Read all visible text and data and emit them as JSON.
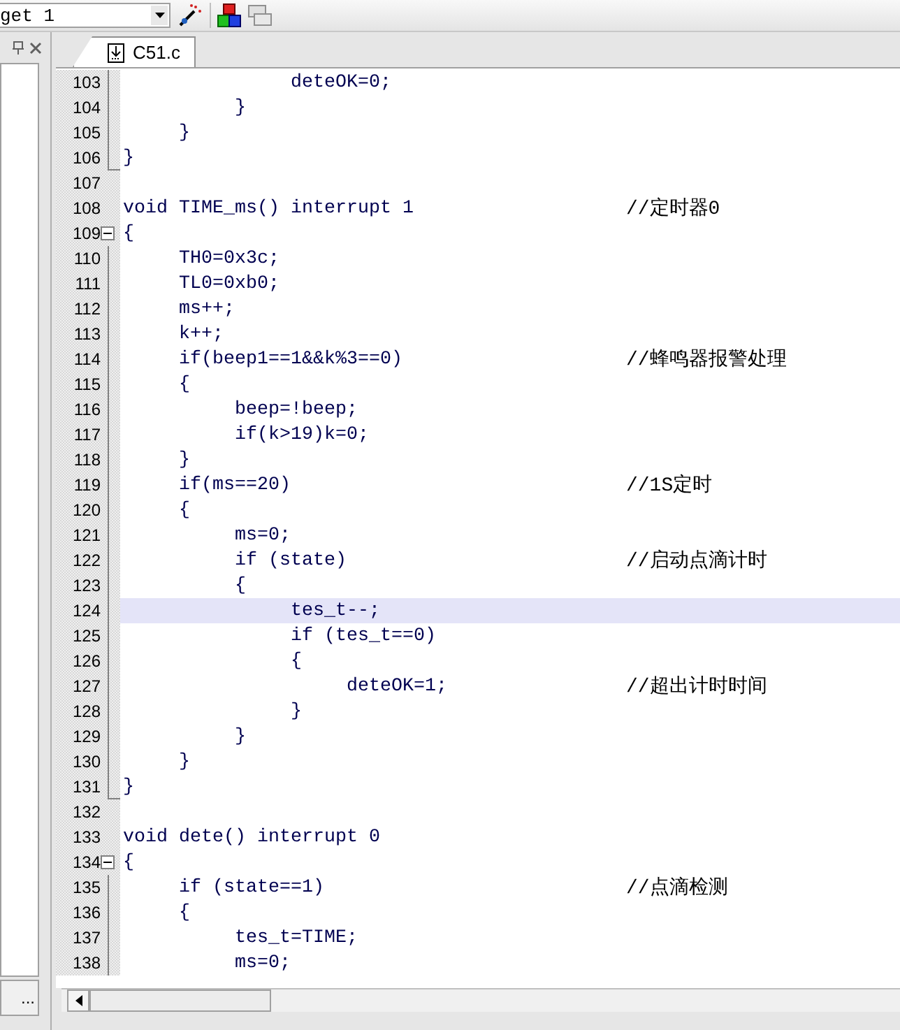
{
  "toolbar": {
    "target": "get 1"
  },
  "left_panel": {
    "tab_label": "..."
  },
  "editor": {
    "tab": {
      "label": "C51.c",
      "selected": true
    },
    "lines": [
      {
        "number": "103",
        "code": "               deteOK=0;",
        "kind": "fold-body",
        "current": false
      },
      {
        "number": "104",
        "code": "          }",
        "kind": "fold-body",
        "current": false
      },
      {
        "number": "105",
        "code": "     }",
        "kind": "fold-body",
        "current": false
      },
      {
        "number": "106",
        "code": "}",
        "kind": "fold-end",
        "current": false
      },
      {
        "number": "107",
        "kind": "plain",
        "current": false
      },
      {
        "number": "108",
        "code": "void TIME_ms() interrupt 1",
        "comment": "//定时器0",
        "kind": "plain",
        "current": false
      },
      {
        "number": "109",
        "code": "{",
        "kind": "fold-start",
        "current": false
      },
      {
        "number": "110",
        "code": "     TH0=0x3c;",
        "kind": "fold-body",
        "current": false
      },
      {
        "number": "111",
        "code": "     TL0=0xb0;",
        "kind": "fold-body",
        "current": false
      },
      {
        "number": "112",
        "code": "     ms++;",
        "kind": "fold-body",
        "current": false
      },
      {
        "number": "113",
        "code": "     k++;",
        "kind": "fold-body",
        "current": false
      },
      {
        "number": "114",
        "code": "     if(beep1==1&&k%3==0)",
        "comment": "//蜂鸣器报警处理",
        "kind": "fold-body",
        "current": false
      },
      {
        "number": "115",
        "code": "     {",
        "kind": "fold-body",
        "current": false
      },
      {
        "number": "116",
        "code": "          beep=!beep;",
        "kind": "fold-body",
        "current": false
      },
      {
        "number": "117",
        "code": "          if(k>19)k=0;",
        "kind": "fold-body",
        "current": false
      },
      {
        "number": "118",
        "code": "     }",
        "kind": "fold-body",
        "current": false
      },
      {
        "number": "119",
        "code": "     if(ms==20)",
        "comment": "//1S定时",
        "kind": "fold-body",
        "current": false
      },
      {
        "number": "120",
        "code": "     {",
        "kind": "fold-body",
        "current": false
      },
      {
        "number": "121",
        "code": "          ms=0;",
        "kind": "fold-body",
        "current": false
      },
      {
        "number": "122",
        "code": "          if (state)",
        "comment": "//启动点滴计时",
        "kind": "fold-body",
        "current": false
      },
      {
        "number": "123",
        "code": "          {",
        "kind": "fold-body",
        "current": false
      },
      {
        "number": "124",
        "code": "               tes_t--;",
        "kind": "fold-body",
        "current": true
      },
      {
        "number": "125",
        "code": "               if (tes_t==0)",
        "kind": "fold-body",
        "current": false
      },
      {
        "number": "126",
        "code": "               {",
        "kind": "fold-body",
        "current": false
      },
      {
        "number": "127",
        "code": "                    deteOK=1;",
        "comment": "//超出计时时间",
        "kind": "fold-body",
        "current": false
      },
      {
        "number": "128",
        "code": "               }",
        "kind": "fold-body",
        "current": false
      },
      {
        "number": "129",
        "code": "          }",
        "kind": "fold-body",
        "current": false
      },
      {
        "number": "130",
        "code": "     }",
        "kind": "fold-body",
        "current": false
      },
      {
        "number": "131",
        "code": "}",
        "kind": "fold-end",
        "current": false
      },
      {
        "number": "132",
        "kind": "plain",
        "current": false
      },
      {
        "number": "133",
        "code": "void dete() interrupt 0",
        "kind": "plain",
        "current": false
      },
      {
        "number": "134",
        "code": "{",
        "kind": "fold-start",
        "current": false
      },
      {
        "number": "135",
        "code": "     if (state==1)",
        "comment": "//点滴检测",
        "kind": "fold-body",
        "current": false
      },
      {
        "number": "136",
        "code": "     {",
        "kind": "fold-body",
        "current": false
      },
      {
        "number": "137",
        "code": "          tes_t=TIME;",
        "kind": "fold-body",
        "current": false
      },
      {
        "number": "138",
        "code": "          ms=0;",
        "kind": "fold-body",
        "current": false
      }
    ]
  }
}
